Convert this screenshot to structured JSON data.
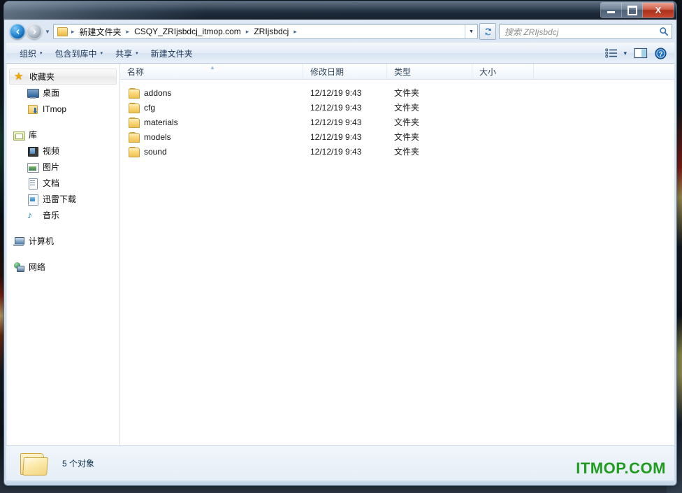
{
  "window": {
    "controls": {
      "minimize": "—",
      "maximize": "□",
      "close": "X"
    }
  },
  "address_bar": {
    "back_icon": "back-arrow-icon",
    "forward_icon": "forward-arrow-icon",
    "history_icon": "chevron-down-icon",
    "folder_icon": "folder-icon",
    "crumbs": [
      "新建文件夹",
      "CSQY_ZRIjsbdcj_itmop.com",
      "ZRIjsbdcj"
    ],
    "separator": "▸",
    "dropdown_icon": "chevron-down-icon",
    "refresh_icon": "refresh-icon"
  },
  "search": {
    "placeholder": "搜索 ZRIjsbdcj",
    "icon": "search-icon"
  },
  "command_bar": {
    "items": [
      {
        "label": "组织",
        "has_menu": true
      },
      {
        "label": "包含到库中",
        "has_menu": true
      },
      {
        "label": "共享",
        "has_menu": true
      },
      {
        "label": "新建文件夹",
        "has_menu": false
      }
    ],
    "caret": "▾",
    "view_icon": "view-options-icon",
    "view_caret": "▾",
    "preview_pane_icon": "preview-pane-icon",
    "help_icon": "help-icon",
    "help_glyph": "?"
  },
  "nav_pane": {
    "groups": [
      {
        "header": {
          "label": "收藏夹",
          "icon": "star-icon",
          "selected": true
        },
        "items": [
          {
            "label": "桌面",
            "icon": "desktop-icon"
          },
          {
            "label": "ITmop",
            "icon": "download-folder-icon"
          }
        ]
      },
      {
        "header": {
          "label": "库",
          "icon": "library-icon",
          "selected": false
        },
        "items": [
          {
            "label": "视频",
            "icon": "video-library-icon"
          },
          {
            "label": "图片",
            "icon": "pictures-library-icon"
          },
          {
            "label": "文档",
            "icon": "documents-library-icon"
          },
          {
            "label": "迅雷下载",
            "icon": "xunlei-download-icon"
          },
          {
            "label": "音乐",
            "icon": "music-library-icon"
          }
        ]
      },
      {
        "header": {
          "label": "计算机",
          "icon": "computer-icon",
          "selected": false
        },
        "items": []
      },
      {
        "header": {
          "label": "网络",
          "icon": "network-icon",
          "selected": false
        },
        "items": []
      }
    ]
  },
  "file_list": {
    "columns": [
      {
        "label": "名称",
        "sorted": true,
        "sort_direction": "asc",
        "sort_glyph": "▲"
      },
      {
        "label": "修改日期",
        "sorted": false
      },
      {
        "label": "类型",
        "sorted": false
      },
      {
        "label": "大小",
        "sorted": false
      }
    ],
    "rows": [
      {
        "name": "addons",
        "date": "12/12/19 9:43",
        "type": "文件夹",
        "size": "",
        "icon": "folder-icon"
      },
      {
        "name": "cfg",
        "date": "12/12/19 9:43",
        "type": "文件夹",
        "size": "",
        "icon": "folder-icon"
      },
      {
        "name": "materials",
        "date": "12/12/19 9:43",
        "type": "文件夹",
        "size": "",
        "icon": "folder-icon"
      },
      {
        "name": "models",
        "date": "12/12/19 9:43",
        "type": "文件夹",
        "size": "",
        "icon": "folder-icon"
      },
      {
        "name": "sound",
        "date": "12/12/19 9:43",
        "type": "文件夹",
        "size": "",
        "icon": "folder-icon"
      }
    ]
  },
  "status_bar": {
    "text": "5 个对象",
    "icon": "folder-icon"
  },
  "watermark": {
    "text": "ITMOP.COM",
    "color": "#1f9c1f"
  }
}
